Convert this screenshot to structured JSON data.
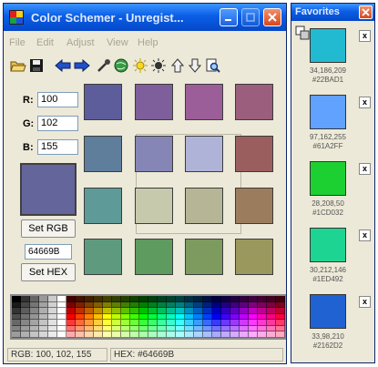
{
  "window": {
    "title": "Color Schemer - Unregist...",
    "colors": {
      "titlebar": "#0a5ee6",
      "face": "#ece9d8"
    }
  },
  "menu": [
    "File",
    "Edit",
    "Adjust",
    "View",
    "Help"
  ],
  "toolbar": {
    "icons": [
      "open-folder-icon",
      "save-icon",
      "arrow-left-icon",
      "arrow-right-icon",
      "eyedropper-icon",
      "web-globe-icon",
      "lighten-icon",
      "darken-icon",
      "arrow-up-icon",
      "arrow-down-icon",
      "page-search-icon"
    ]
  },
  "rgb": {
    "r_label": "R:",
    "r_value": "100",
    "g_label": "G:",
    "g_value": "102",
    "b_label": "B:",
    "b_value": "155",
    "current_color": "#64669B",
    "set_rgb_label": "Set RGB",
    "hex_value": "64669B",
    "set_hex_label": "Set HEX"
  },
  "scheme": {
    "rows": [
      [
        "#5e5d9b",
        "#7f5f9b",
        "#9b5e98",
        "#9b5e7d"
      ],
      [
        "#5e7e9b",
        "#8586b6",
        "#b0b3d8",
        "#9b5e5f"
      ],
      [
        "#5e9b98",
        "#c7c9ad",
        "#b6b596",
        "#9b7d5e"
      ],
      [
        "#5e9b7e",
        "#5e9b5f",
        "#7d9b5e",
        "#9b985e"
      ]
    ]
  },
  "palette": {
    "hue_stops": [
      "#ff0000",
      "#ff8000",
      "#ffff00",
      "#80ff00",
      "#00ff00",
      "#00ff80",
      "#00ffff",
      "#0080ff",
      "#0000ff",
      "#8000ff",
      "#ff00ff",
      "#ff0080"
    ],
    "grays": [
      "#000000",
      "#333333",
      "#666666",
      "#999999",
      "#cccccc",
      "#ffffff"
    ]
  },
  "status": {
    "rgb": "RGB: 100, 102, 155",
    "hex": "HEX: #64669B"
  },
  "favorites": {
    "title": "Favorites",
    "items": [
      {
        "color": "#22BAD1",
        "rgb": "34,186,209",
        "hex": "#22BAD1"
      },
      {
        "color": "#61A2FF",
        "rgb": "97,162,255",
        "hex": "#61A2FF"
      },
      {
        "color": "#1CD032",
        "rgb": "28,208,50",
        "hex": "#1CD032"
      },
      {
        "color": "#1ED492",
        "rgb": "30,212,146",
        "hex": "#1ED492"
      },
      {
        "color": "#2162D2",
        "rgb": "33,98,210",
        "hex": "#2162D2"
      }
    ]
  }
}
